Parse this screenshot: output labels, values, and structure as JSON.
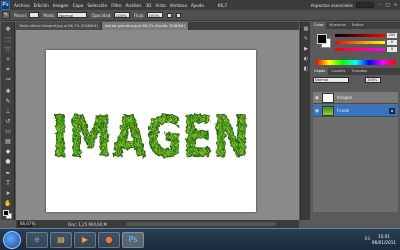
{
  "app": {
    "logo": "Ps",
    "menu": [
      "Archivo",
      "Edición",
      "Imagen",
      "Capa",
      "Selección",
      "Filtro",
      "Análisis",
      "3D",
      "Vista",
      "Ventana",
      "Ayuda"
    ],
    "zoom_menu": "66,7",
    "workspace_label": "Aspectos esenciales"
  },
  "options": {
    "preset_label": "Pincel:",
    "mode_label": "Modo:",
    "mode_value": "Normal",
    "opacity_label": "Opacidad:",
    "opacity_value": "100%",
    "flow_label": "Flujo:",
    "flow_value": "100%"
  },
  "tabs": [
    {
      "label": "Texto efecto fotograf.jpg al 66,7% (RGB/8#)",
      "active": false
    },
    {
      "label": "hierba grande.jpg al 66,7% (Fondo, RGB/8#)",
      "active": true
    }
  ],
  "document": {
    "text": "IMAGEN",
    "texture_colors": [
      "#2f6b12",
      "#5aa31f",
      "#8ccf3a"
    ]
  },
  "status": {
    "zoom": "66,67%",
    "doc_info": "Doc: 1,25 M/4,60 M"
  },
  "panels": {
    "color_tabs": [
      "Color",
      "Muestras",
      "Estilos"
    ],
    "slider_values": [
      "255",
      "0",
      "0"
    ],
    "layer_tabs": [
      "Capas",
      "Canales",
      "Trazados"
    ],
    "blend_mode": "Normal",
    "opacity": "100%",
    "layers": [
      {
        "name": "Imagen",
        "selected": false
      },
      {
        "name": "Fondo",
        "selected": true
      }
    ]
  },
  "taskbar": {
    "apps": [
      "IE",
      "Explorer",
      "Player",
      "Firefox",
      "Photoshop"
    ],
    "tray": "ES",
    "time": "15:01",
    "date": "06/01/2011"
  }
}
